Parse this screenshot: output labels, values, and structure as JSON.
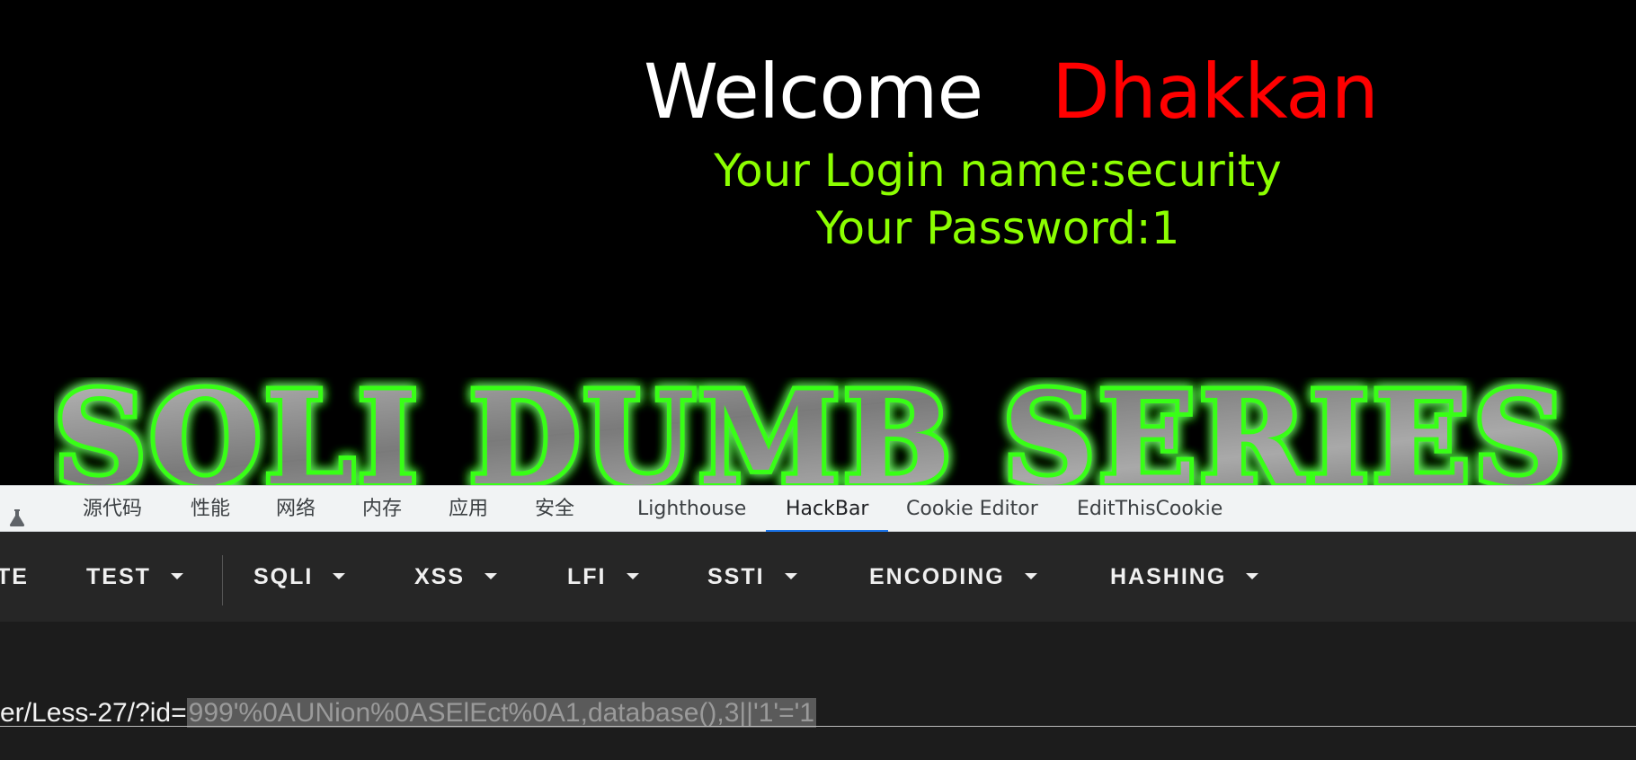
{
  "page": {
    "welcome": "Welcome",
    "name": "Dhakkan",
    "login_line": "Your Login name:security",
    "password_line": "Your Password:1",
    "banner_text": "SQLI DUMB SERIES",
    "colors": {
      "welcome": "#ffffff",
      "name": "#ff0000",
      "info": "#8cff00",
      "banner_glow": "#39ff14"
    }
  },
  "devtools": {
    "tabs": [
      {
        "label": "源代码"
      },
      {
        "label": "性能"
      },
      {
        "label": "网络"
      },
      {
        "label": "内存"
      },
      {
        "label": "应用"
      },
      {
        "label": "安全"
      },
      {
        "label": "Lighthouse"
      },
      {
        "label": "HackBar",
        "active": true
      },
      {
        "label": "Cookie Editor"
      },
      {
        "label": "EditThisCookie"
      }
    ],
    "flask_icon": "flask-icon",
    "accent": "#1a73e8"
  },
  "hackbar": {
    "menus": [
      {
        "label": "TE"
      },
      {
        "label": "TEST"
      },
      {
        "label": "SQLI"
      },
      {
        "label": "XSS"
      },
      {
        "label": "LFI"
      },
      {
        "label": "SSTI"
      },
      {
        "label": "ENCODING"
      },
      {
        "label": "HASHING"
      }
    ],
    "url_prefix": "er/Less-27/?id=",
    "url_selected": "999'%0AUNion%0ASElEct%0A1,database(),3||'1'='1"
  }
}
